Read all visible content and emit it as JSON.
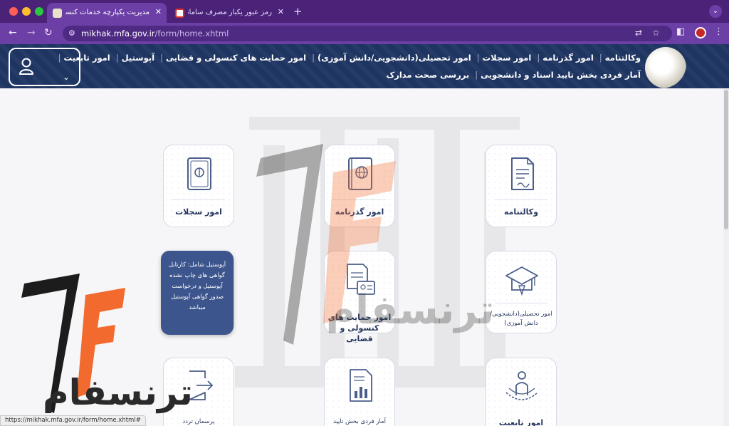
{
  "browser": {
    "tabs": [
      {
        "title": "مدیریت یکپارچه خدمات کنسولی",
        "active": true
      },
      {
        "title": "رمز عبور یکبار مصرف سامانه مدیر...",
        "active": false
      }
    ],
    "tab_close": "✕",
    "new_tab": "+",
    "tab_menu": "⌄",
    "url_host": "mikhak.mfa.gov.ir",
    "url_path": "/form/home.xhtml",
    "status_url": "https://mikhak.mfa.gov.ir/form/home.xhtml#"
  },
  "header": {
    "nav_line1": [
      "وکالتنامه",
      "امور گذرنامه",
      "امور سجلات",
      "امور تحصیلی(دانشجویی/دانش آموزی)",
      "امور حمایت های کنسولی و قضایی",
      "آپوستیل",
      "امور تابعیت"
    ],
    "nav_line2": [
      "آمار فردی بخش تایید اسناد و دانشجویی",
      "بررسی صحت مدارک"
    ]
  },
  "cards": {
    "sejelat": "امور سجلات",
    "gozarname": "امور گذرنامه",
    "vekalat": "وکالتنامه",
    "hemayat": "امور حمایت های کنسولی و قضایی",
    "tahsili": "امور تحصیلی(دانشجویی/دانش آموزی)",
    "porsman": "پرسمان تردد",
    "amar": "آمار فردی بخش تایید",
    "tabeiat": "امور تابعیت",
    "apostille_tooltip": "آپوستیل شامل: کارتابل گواهی های چاپ نشده آپوستیل و درخواست صدور گواهی آپوستیل میباشد"
  },
  "watermark": {
    "text": "ترنسفام"
  },
  "colors": {
    "chrome": "#4a2378",
    "header": "#1e3461",
    "accent_orange": "#f26a2e",
    "card_text": "#26375e"
  }
}
